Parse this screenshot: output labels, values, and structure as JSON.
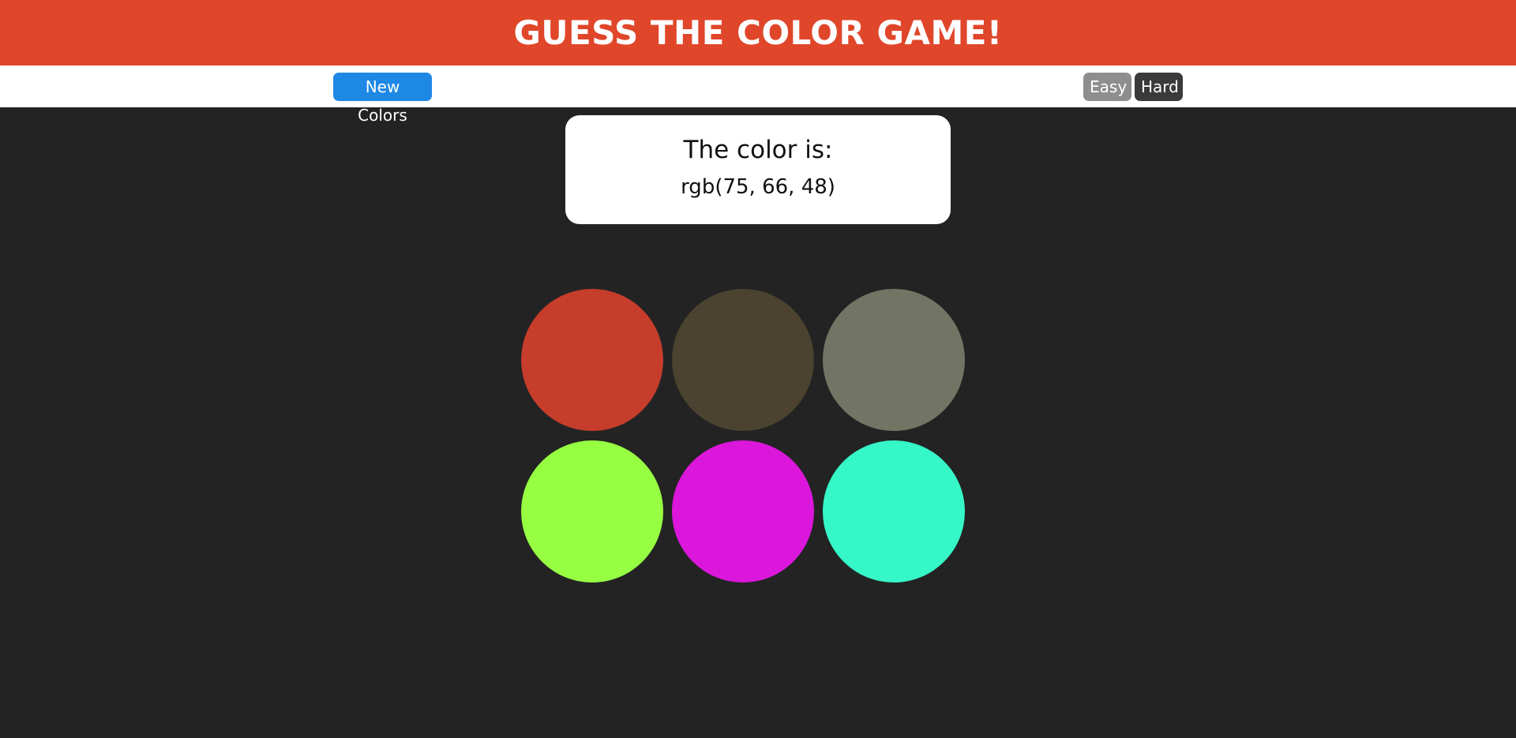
{
  "colors": {
    "header_bg": "#E0462A",
    "stripe_bg": "#FFFFFF",
    "page_bg": "#232323",
    "new_colors_bg": "#1E88E5",
    "easy_bg": "#8E8E8E",
    "hard_bg": "#3A3A3A"
  },
  "header": {
    "title": "GUESS THE COLOR GAME!"
  },
  "stripe": {
    "new_colors_label": "New Colors",
    "easy_label": "Easy",
    "hard_label": "Hard",
    "selected_mode": "Hard"
  },
  "target": {
    "label": "The color is:",
    "value": "rgb(75, 66, 48)"
  },
  "squares": [
    {
      "color": "#C63D2B"
    },
    {
      "color": "#4B4230"
    },
    {
      "color": "#727564"
    },
    {
      "color": "#96FF42"
    },
    {
      "color": "#DA17DA"
    },
    {
      "color": "#36F7C7"
    }
  ]
}
